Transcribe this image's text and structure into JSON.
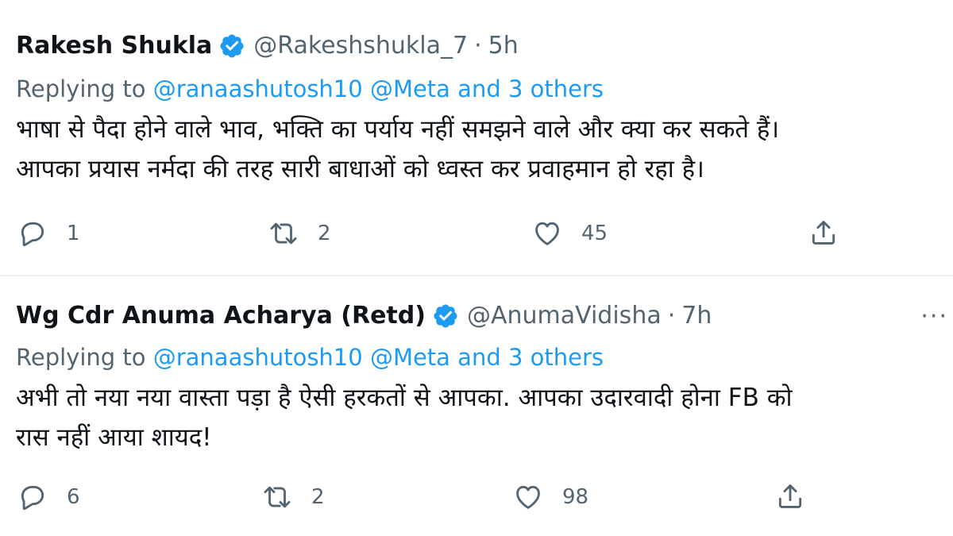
{
  "tweets": [
    {
      "name": "Rakesh Shukla",
      "handle": "@Rakeshshukla_7",
      "separator": "·",
      "time": "5h",
      "replying_prefix": "Replying to ",
      "mention1": "@ranaashutosh10",
      "mention2": "@Meta",
      "and": " and ",
      "others": "3 others",
      "body_lines": [
        "भाषा से पैदा होने वाले भाव, भक्ति का पर्याय नहीं समझने वाले और क्या कर सकते हैं।",
        "आपका प्रयास नर्मदा की तरह सारी बाधाओं को ध्वस्त कर प्रवाहमान हो रहा है।"
      ],
      "reply_count": "1",
      "retweet_count": "2",
      "like_count": "45",
      "icons": {
        "verified": "verified-badge-icon",
        "reply": "reply-bubble-icon",
        "retweet": "retweet-icon",
        "like": "heart-icon",
        "share": "share-icon"
      }
    },
    {
      "name": "Wg Cdr Anuma Acharya (Retd)",
      "handle": "@AnumaVidisha",
      "separator": "·",
      "time": "7h",
      "more": "···",
      "replying_prefix": "Replying to ",
      "mention1": "@ranaashutosh10",
      "mention2": "@Meta",
      "and": " and ",
      "others": "3 others",
      "body_lines": [
        "अभी तो नया नया वास्ता पड़ा है ऐसी हरकतों से आपका. आपका उदारवादी होना FB को",
        "रास नहीं आया शायद!"
      ],
      "reply_count": "6",
      "retweet_count": "2",
      "like_count": "98",
      "icons": {
        "verified": "verified-badge-icon",
        "more": "more-options-icon",
        "reply": "reply-bubble-icon",
        "retweet": "retweet-icon",
        "like": "heart-icon",
        "share": "share-icon"
      }
    }
  ],
  "colors": {
    "text": "#0f1419",
    "secondary": "#536471",
    "link": "#1d9bf0",
    "verified": "#1d9bf0",
    "divider": "#eff3f4"
  }
}
